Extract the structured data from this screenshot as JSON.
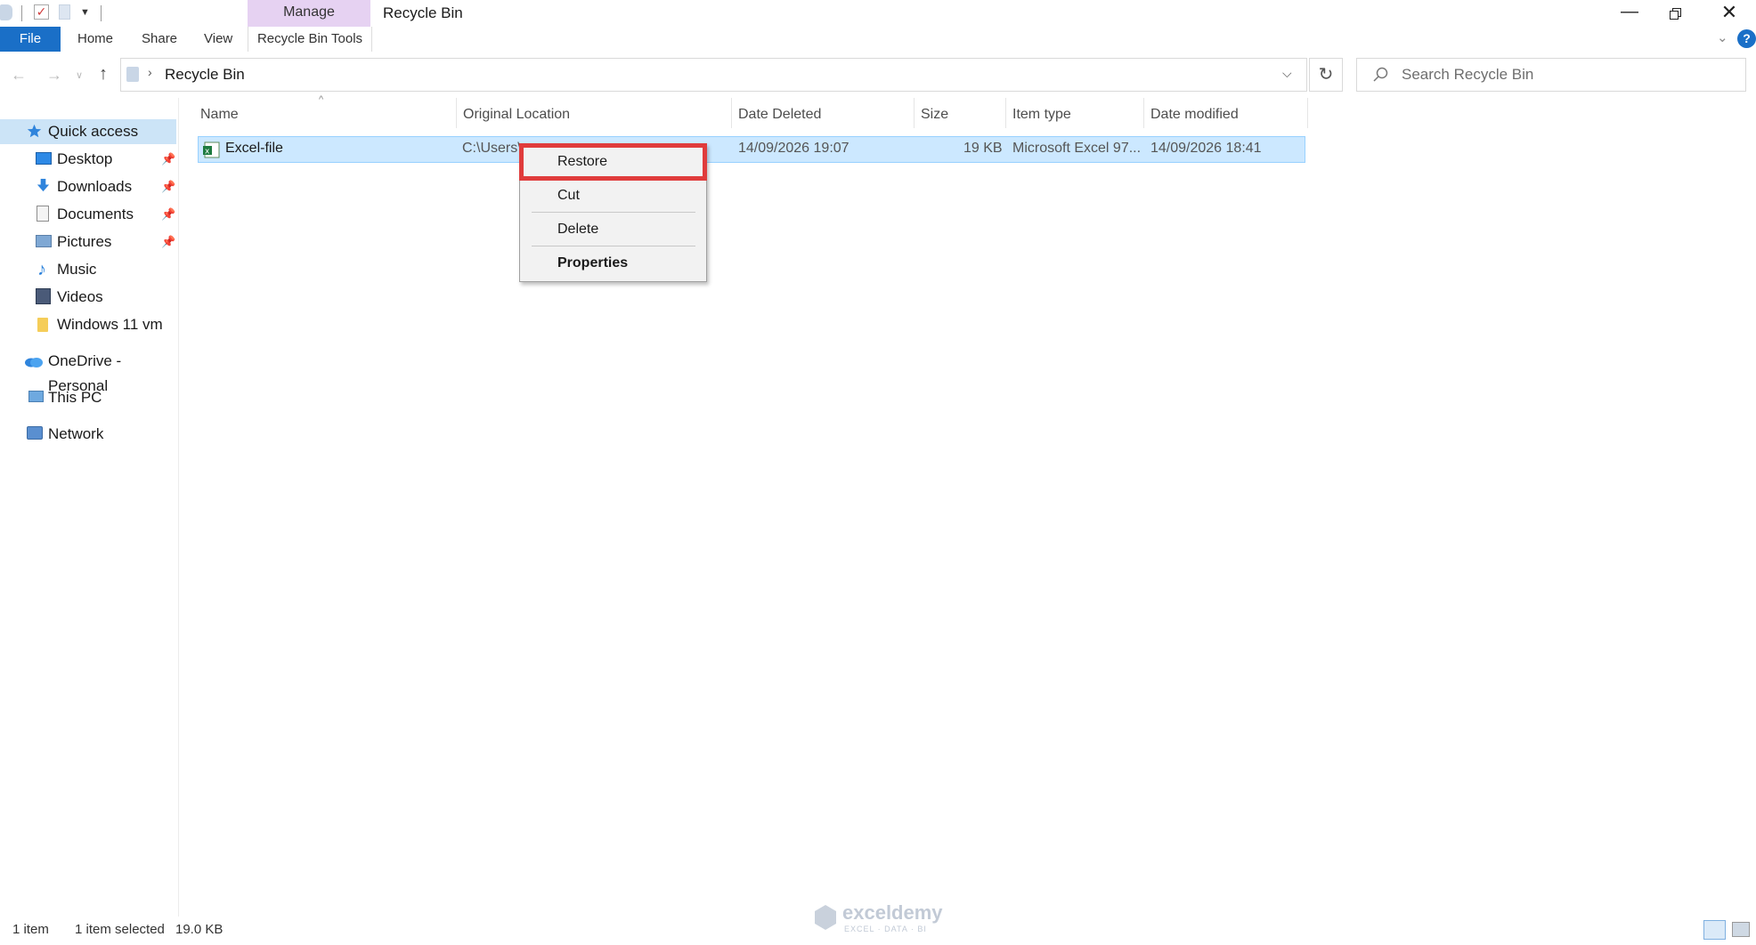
{
  "window": {
    "title": "Recycle Bin",
    "contextual_tab_group": "Manage",
    "controls": {
      "minimize": "—",
      "close": "✕"
    }
  },
  "ribbon": {
    "file": "File",
    "tabs": [
      "Home",
      "Share",
      "View",
      "Recycle Bin Tools"
    ],
    "help": "?"
  },
  "address": {
    "path": "Recycle Bin",
    "search_placeholder": "Search Recycle Bin"
  },
  "sidebar": {
    "quick_access": "Quick access",
    "items": [
      {
        "label": "Desktop",
        "icon": "desktop-icon",
        "pinned": true
      },
      {
        "label": "Downloads",
        "icon": "downloads-icon",
        "pinned": true
      },
      {
        "label": "Documents",
        "icon": "documents-icon",
        "pinned": true
      },
      {
        "label": "Pictures",
        "icon": "pictures-icon",
        "pinned": true
      },
      {
        "label": "Music",
        "icon": "music-icon",
        "pinned": false
      },
      {
        "label": "Videos",
        "icon": "videos-icon",
        "pinned": false
      },
      {
        "label": "Windows 11 vm",
        "icon": "folder-icon",
        "pinned": false
      }
    ],
    "onedrive": "OneDrive - Personal",
    "this_pc": "This PC",
    "network": "Network"
  },
  "columns": [
    "Name",
    "Original Location",
    "Date Deleted",
    "Size",
    "Item type",
    "Date modified"
  ],
  "files": [
    {
      "name": "Excel-file",
      "original_location": "C:\\Users\\",
      "date_deleted": "14/09/2026 19:07",
      "size": "19 KB",
      "item_type": "Microsoft Excel 97...",
      "date_modified": "14/09/2026 18:41",
      "selected": true
    }
  ],
  "context_menu": {
    "items": [
      "Restore",
      "Cut",
      "Delete",
      "Properties"
    ],
    "highlighted": "Restore",
    "highlight_color": "#e03c3c"
  },
  "status": {
    "item_count": "1 item",
    "selection": "1 item selected",
    "selection_size": "19.0 KB"
  },
  "watermark": {
    "brand": "exceldemy",
    "tagline": "EXCEL · DATA · BI"
  },
  "colors": {
    "accent": "#1a6fc7",
    "selection": "#cce8ff",
    "manage_tab": "#e6d2f2"
  }
}
